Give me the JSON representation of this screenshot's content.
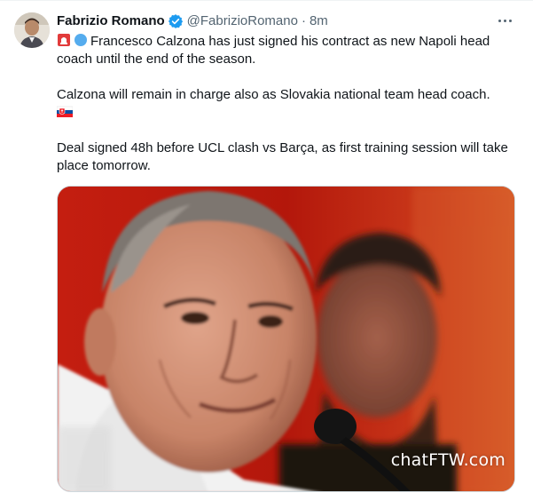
{
  "author": {
    "display_name": "Fabrizio Romano",
    "handle": "@FabrizioRomano",
    "separator": "·",
    "time": "8m",
    "verified": true,
    "avatar_icon": "profile-photo"
  },
  "tweet": {
    "line1_text": "Francesco Calzona has just signed his contract as new Napoli head coach until the end of the season.",
    "line1_emojis": [
      "alarm-light-emoji",
      "blue-circle-emoji"
    ],
    "line2_text": "Calzona will remain in charge also as Slovakia national team head coach.",
    "line2_emoji": "slovakia-flag-emoji",
    "line3_text": "Deal signed 48h before UCL clash vs Barça, as first training session will take place tomorrow."
  },
  "media": {
    "watermark": "chatFTW.com",
    "description_icon": "press-conference-photo"
  },
  "colors": {
    "text_primary": "#0f1419",
    "text_secondary": "#536471",
    "verified_blue": "#1d9bf0",
    "photo_red": "#b71a0d"
  }
}
